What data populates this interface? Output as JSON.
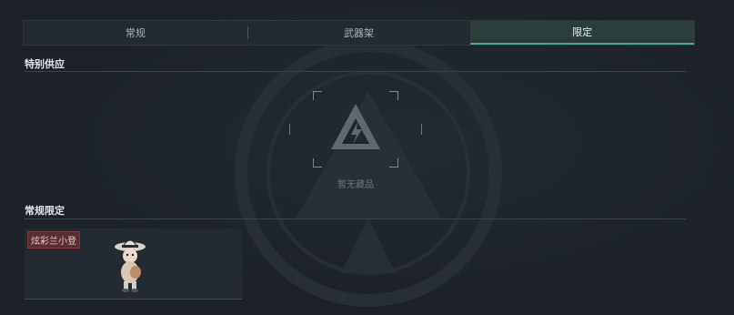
{
  "tabs": [
    {
      "label": "常规",
      "active": false
    },
    {
      "label": "武器架",
      "active": false
    },
    {
      "label": "限定",
      "active": true
    }
  ],
  "sections": {
    "special_supply": {
      "title": "特别供应",
      "empty_text": "暂无藏品"
    },
    "regular_limited": {
      "title": "常规限定",
      "items": [
        {
          "name": "炫彩兰小登",
          "icon": "character-sprite-icon"
        }
      ]
    }
  },
  "colors": {
    "background": "#1c2228",
    "active_tab_accent": "#4fa58b",
    "item_tag_bg": "#5b2c30"
  }
}
